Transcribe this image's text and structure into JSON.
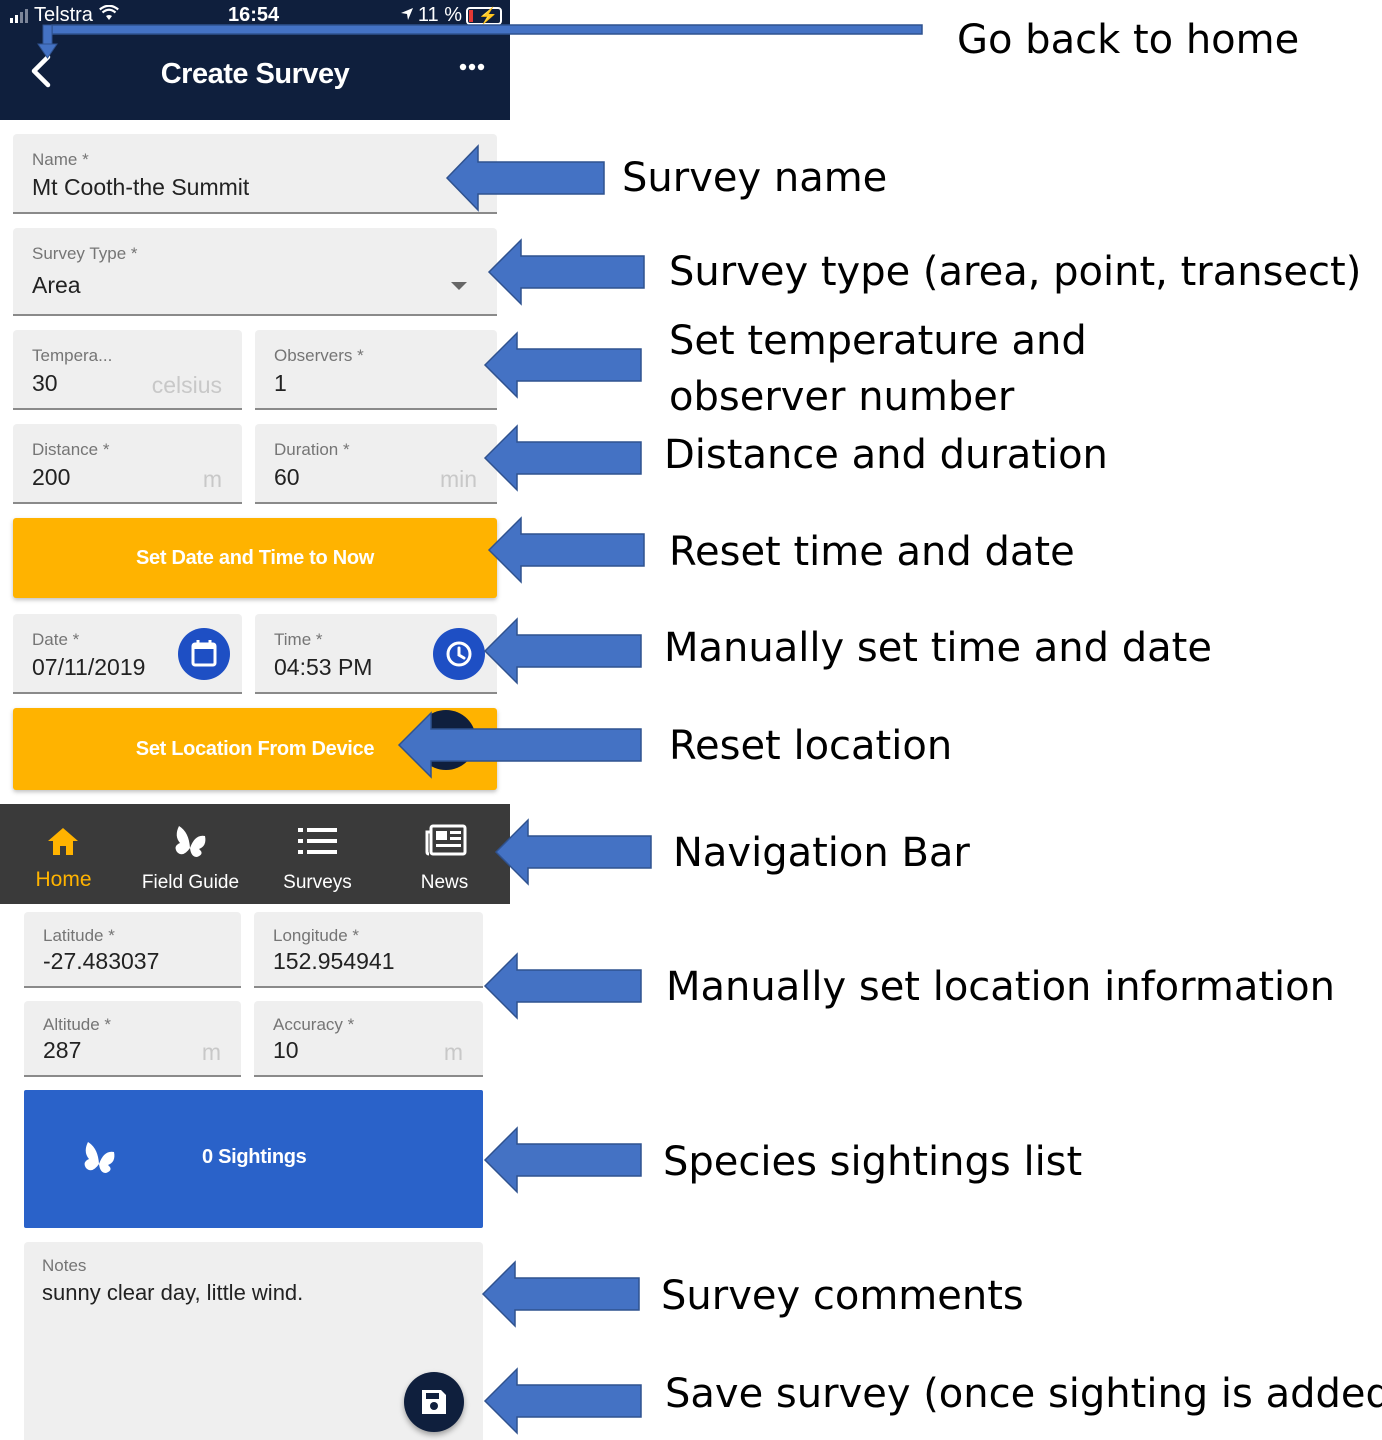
{
  "status_bar": {
    "carrier": "Telstra",
    "time": "16:54",
    "battery": "11 %"
  },
  "app_bar": {
    "title": "Create Survey",
    "back_icon": "chevron-left-icon",
    "more_icon": "more-horizontal-icon"
  },
  "form": {
    "name": {
      "label": "Name *",
      "value": "Mt Cooth-the Summit"
    },
    "survey_type": {
      "label": "Survey Type *",
      "value": "Area"
    },
    "temperature": {
      "label": "Tempera...",
      "value": "30",
      "unit": "celsius"
    },
    "observers": {
      "label": "Observers *",
      "value": "1"
    },
    "distance": {
      "label": "Distance *",
      "value": "200",
      "unit": "m"
    },
    "duration": {
      "label": "Duration *",
      "value": "60",
      "unit": "min"
    },
    "set_datetime_label": "Set Date and Time to Now",
    "date": {
      "label": "Date *",
      "value": "07/11/2019"
    },
    "time": {
      "label": "Time *",
      "value": "04:53 PM"
    },
    "set_location_label": "Set Location From Device",
    "latitude": {
      "label": "Latitude *",
      "value": "-27.483037"
    },
    "longitude": {
      "label": "Longitude *",
      "value": "152.954941"
    },
    "altitude": {
      "label": "Altitude *",
      "value": "287",
      "unit": "m"
    },
    "accuracy": {
      "label": "Accuracy *",
      "value": "10",
      "unit": "m"
    },
    "sightings_label": "0 Sightings",
    "notes": {
      "label": "Notes",
      "value": "sunny clear day, little wind."
    }
  },
  "nav": {
    "items": [
      {
        "label": "Home",
        "icon": "home-icon",
        "active": true
      },
      {
        "label": "Field Guide",
        "icon": "butterfly-icon",
        "active": false
      },
      {
        "label": "Surveys",
        "icon": "list-icon",
        "active": false
      },
      {
        "label": "News",
        "icon": "newspaper-icon",
        "active": false
      }
    ]
  },
  "annotations": {
    "back": "Go back to home",
    "name": "Survey name",
    "type": "Survey type (area, point, transect)",
    "temp_line1": "Set temperature and",
    "temp_line2": "observer number",
    "distance": "Distance and duration",
    "reset_time": "Reset time and date",
    "manual_time": "Manually set time and date",
    "reset_location": "Reset location",
    "nav": "Navigation Bar",
    "manual_location": "Manually set location information",
    "sightings": "Species sightings list",
    "comments": "Survey comments",
    "save": "Save survey (once sighting is added)"
  },
  "colors": {
    "app_bar": "#0f1f3d",
    "amber": "#ffb300",
    "blue": "#2a62c9",
    "arrow": "#4472c4",
    "nav_bg": "#3a3a3a"
  }
}
